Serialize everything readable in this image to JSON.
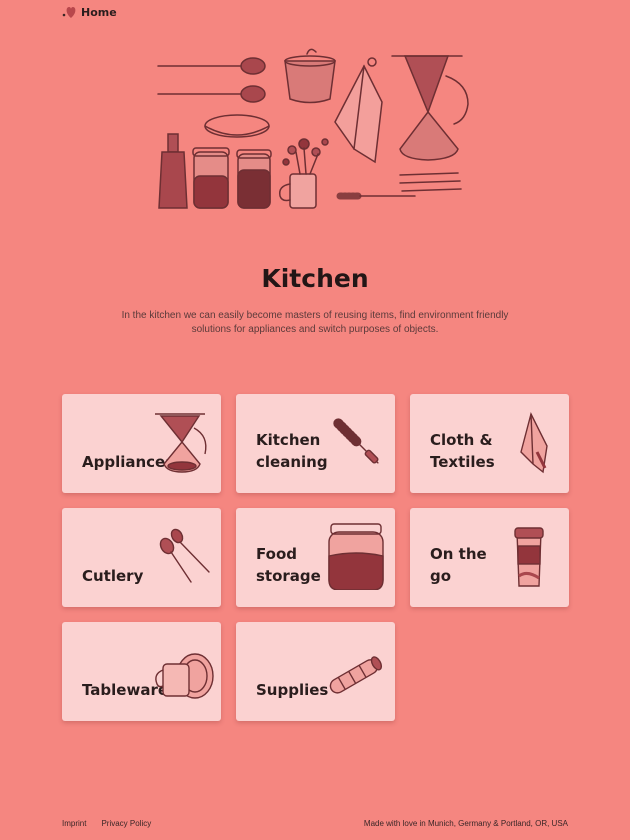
{
  "nav": {
    "home_label": "Home",
    "icon": "heart-icon"
  },
  "page": {
    "title": "Kitchen",
    "intro": "In the kitchen we can easily become masters of reusing items, find environment friendly solutions for appliances and switch purposes of objects."
  },
  "categories": [
    {
      "label": "Appliances",
      "icon": "coffee-maker-icon"
    },
    {
      "label": "Kitchen\ncleaning",
      "icon": "bottle-brush-icon"
    },
    {
      "label": "Cloth &\nTextiles",
      "icon": "tea-towel-icon"
    },
    {
      "label": "Cutlery",
      "icon": "wooden-spoons-icon"
    },
    {
      "label": "Food\nstorage",
      "icon": "storage-jar-icon"
    },
    {
      "label": "On the\ngo",
      "icon": "travel-cup-icon"
    },
    {
      "label": "Tableware",
      "icon": "cups-and-plate-icon"
    },
    {
      "label": "Supplies",
      "icon": "wax-wrap-roll-icon"
    }
  ],
  "footer": {
    "imprint": "Imprint",
    "privacy": "Privacy Policy",
    "credit": "Made with love in Munich, Germany & Portland, OR, USA"
  },
  "colors": {
    "background": "#F58680",
    "card": "#FBD2D1",
    "ink": "#8A3E40",
    "text": "#2a1d1d"
  }
}
